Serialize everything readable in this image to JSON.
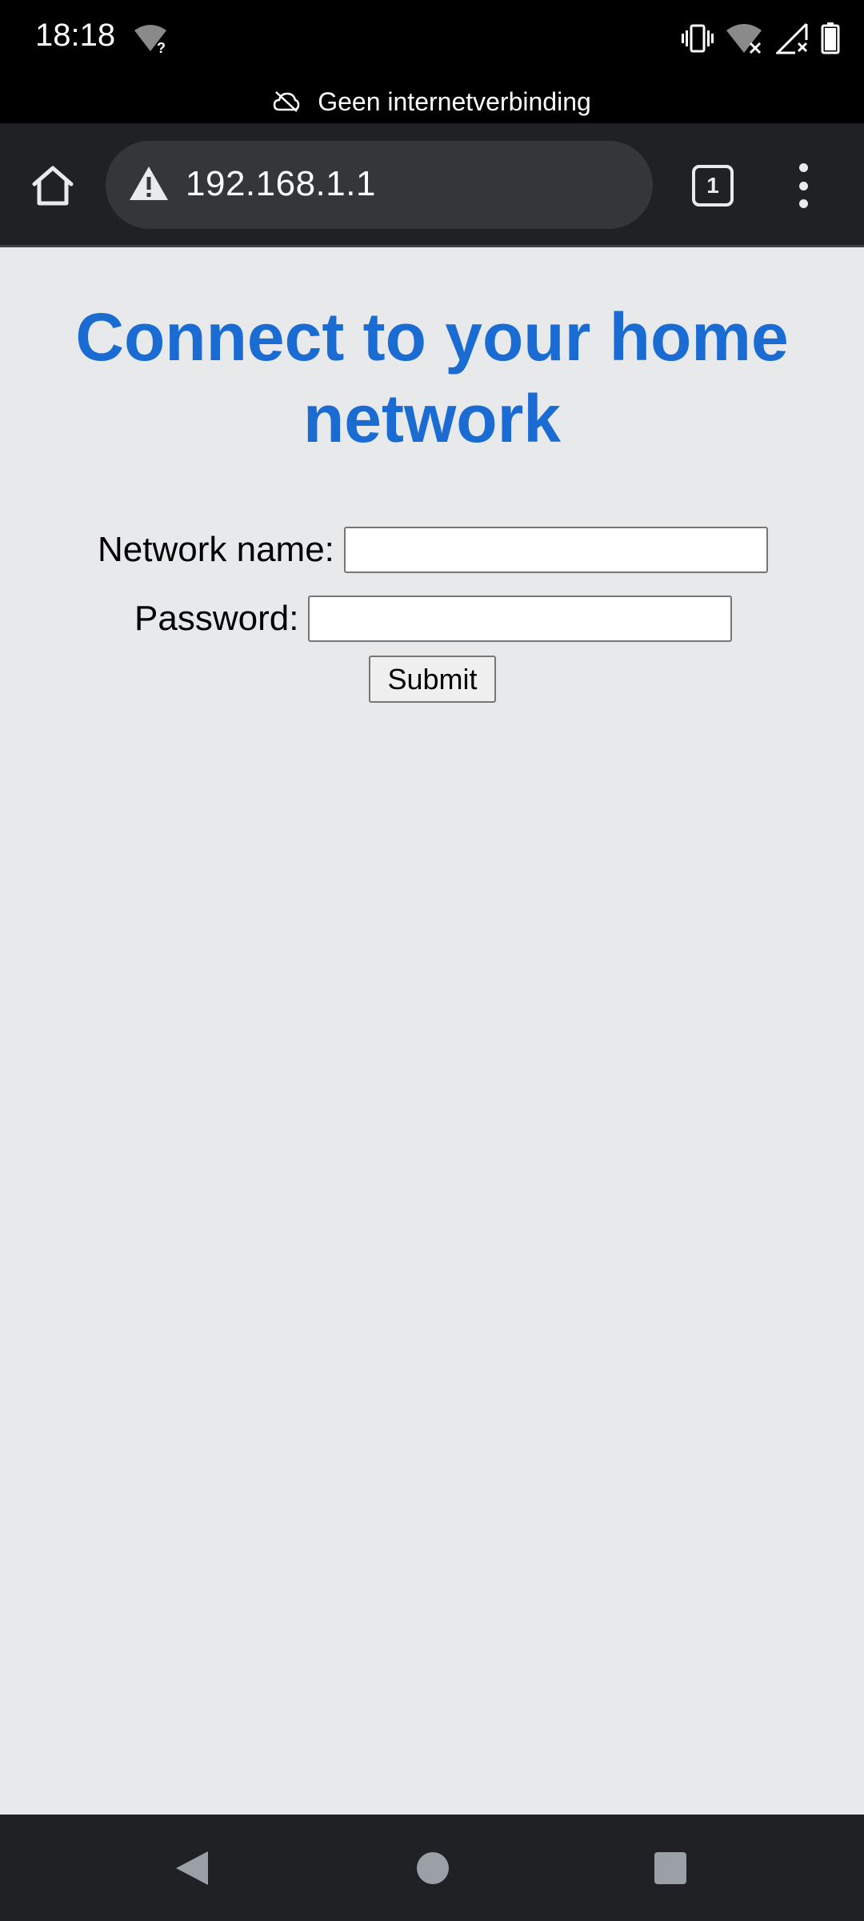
{
  "status_bar": {
    "time": "18:18"
  },
  "offline_banner": {
    "text": "Geen internetverbinding"
  },
  "toolbar": {
    "url": "192.168.1.1",
    "tab_count": "1"
  },
  "page": {
    "title": "Connect to your home network",
    "network_name_label": "Network name:",
    "network_name_value": "",
    "password_label": "Password:",
    "password_value": "",
    "submit_label": "Submit"
  },
  "colors": {
    "title": "#1a6bd2",
    "page_background": "#e8e9eb",
    "toolbar_background": "#202124",
    "omnibox_background": "#35363a"
  },
  "icons": {
    "status": [
      "wifi-unknown-icon",
      "vibrate-icon",
      "wifi-off-icon",
      "signal-off-icon",
      "battery-icon"
    ],
    "offline": "cloud-off-icon",
    "toolbar": [
      "home-icon",
      "warning-icon",
      "tab-switcher-icon",
      "overflow-menu-icon"
    ],
    "nav": [
      "back-icon",
      "home-circle-icon",
      "recents-icon"
    ]
  }
}
